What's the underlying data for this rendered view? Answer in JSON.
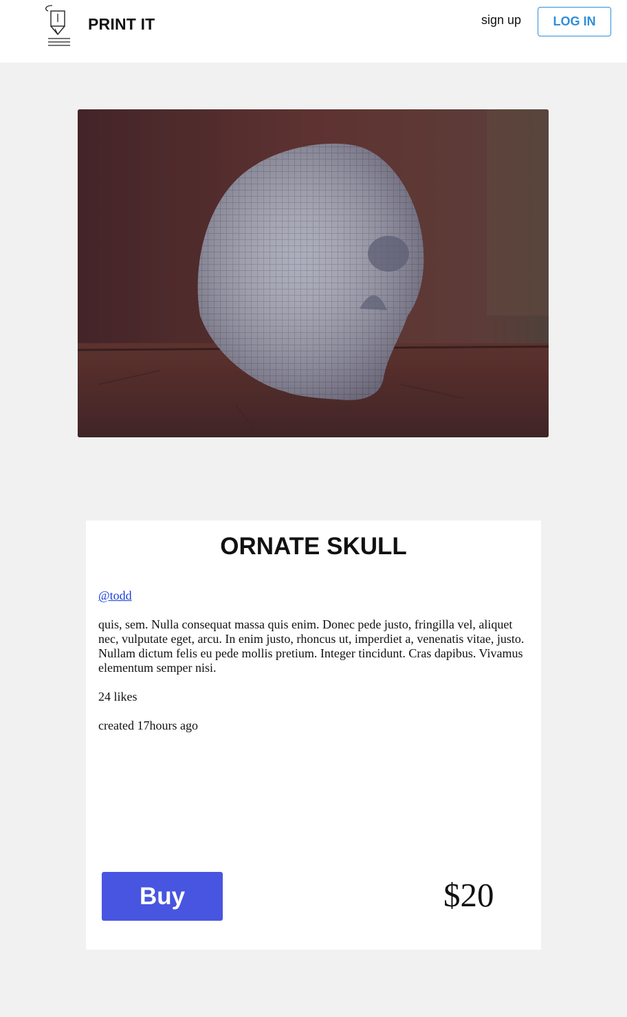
{
  "header": {
    "brand": "PRINT IT",
    "logo_icon": "3d-printer-nozzle-icon",
    "signup_label": "sign up",
    "login_label": "LOG IN"
  },
  "hero": {
    "image_icon": "ornate-skull-photo"
  },
  "product": {
    "title": "ORNATE SKULL",
    "author": "@todd",
    "description": "quis, sem. Nulla consequat massa quis enim. Donec pede justo, fringilla vel, aliquet nec, vulputate eget, arcu. In enim justo, rhoncus ut, imperdiet a, venenatis vitae, justo. Nullam dictum felis eu pede mollis pretium. Integer tincidunt. Cras dapibus. Vivamus elementum semper nisi.",
    "likes": "24 likes",
    "created": "created 17hours ago",
    "buy_label": "Buy",
    "price": "$20"
  },
  "colors": {
    "accent": "#2f8fd9",
    "buy_button": "#4855e0",
    "link": "#1a3fd6",
    "background": "#f1f1f1"
  }
}
